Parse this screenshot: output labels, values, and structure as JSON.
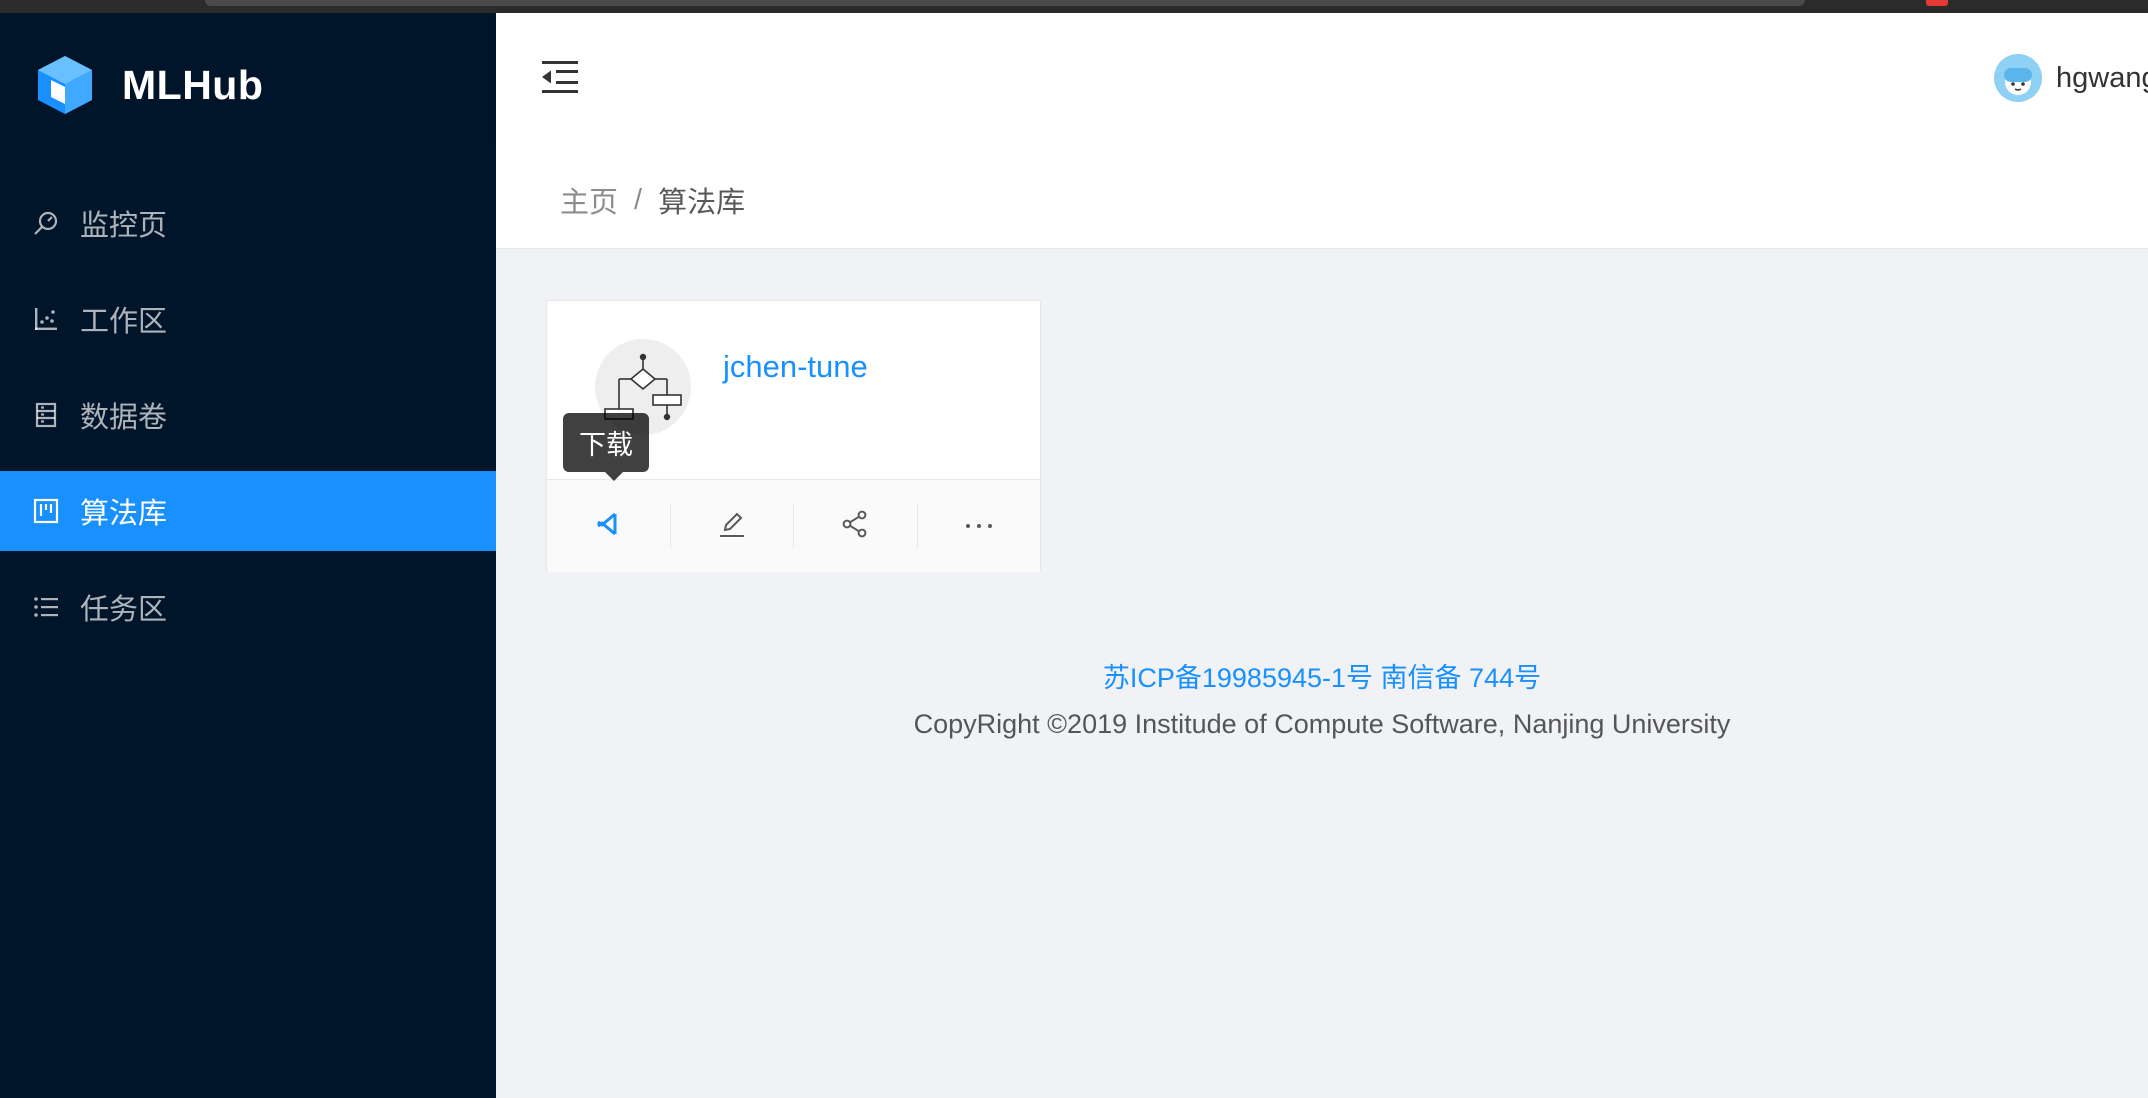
{
  "app": {
    "name": "MLHub",
    "brand_color": "#1890ff",
    "sider_color": "#001529"
  },
  "sidebar": {
    "items": [
      {
        "label": "监控页",
        "icon": "dashboard-icon",
        "active": false
      },
      {
        "label": "工作区",
        "icon": "dot-chart-icon",
        "active": false
      },
      {
        "label": "数据卷",
        "icon": "database-icon",
        "active": false
      },
      {
        "label": "算法库",
        "icon": "project-icon",
        "active": true
      },
      {
        "label": "任务区",
        "icon": "bars-icon",
        "active": false
      }
    ]
  },
  "header": {
    "username": "hgwang",
    "toggle_icon": "menu-fold-icon"
  },
  "breadcrumb": {
    "home": "主页",
    "separator": "/",
    "current": "算法库"
  },
  "card": {
    "title": "jchen-tune",
    "avatar_icon": "flowchart-icon",
    "actions": [
      {
        "name": "download",
        "icon": "vscode-icon"
      },
      {
        "name": "edit",
        "icon": "edit-icon"
      },
      {
        "name": "share",
        "icon": "share-icon"
      },
      {
        "name": "more",
        "icon": "ellipsis-icon"
      }
    ],
    "tooltip": "下载"
  },
  "footer": {
    "icp": "苏ICP备19985945-1号",
    "nanxin": "南信备 744号",
    "copyright": "CopyRight ©2019 Institude of Compute Software, Nanjing University"
  }
}
